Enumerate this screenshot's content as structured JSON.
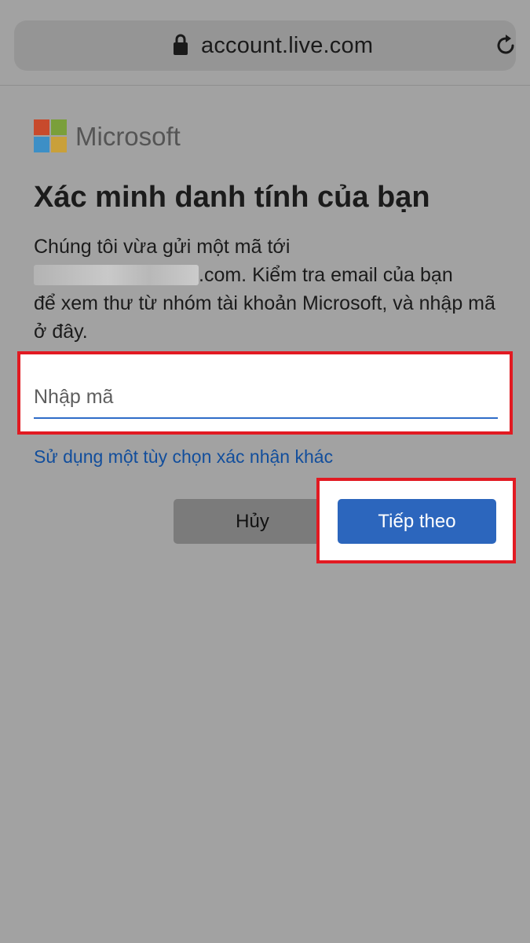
{
  "browser": {
    "url": "account.live.com",
    "lock_icon": "lock-icon",
    "reload_icon": "reload-icon"
  },
  "brand": {
    "name": "Microsoft",
    "logo_colors": [
      "#f25022",
      "#7fba00",
      "#00a4ef",
      "#ffb900"
    ]
  },
  "page": {
    "title": "Xác minh danh tính của bạn",
    "desc_line1": "Chúng tôi vừa gửi một mã tới",
    "desc_email_suffix": ".com. Kiểm tra email của bạn",
    "desc_rest": "để xem thư từ nhóm tài khoản Microsoft, và nhập mã ở đây.",
    "code_placeholder": "Nhập mã",
    "code_value": "",
    "alt_option_link": "Sử dụng một tùy chọn xác nhận khác",
    "cancel_label": "Hủy",
    "next_label": "Tiếp theo"
  },
  "colors": {
    "highlight": "#e21a22",
    "primary": "#2c66bd",
    "link": "#124e9c"
  }
}
